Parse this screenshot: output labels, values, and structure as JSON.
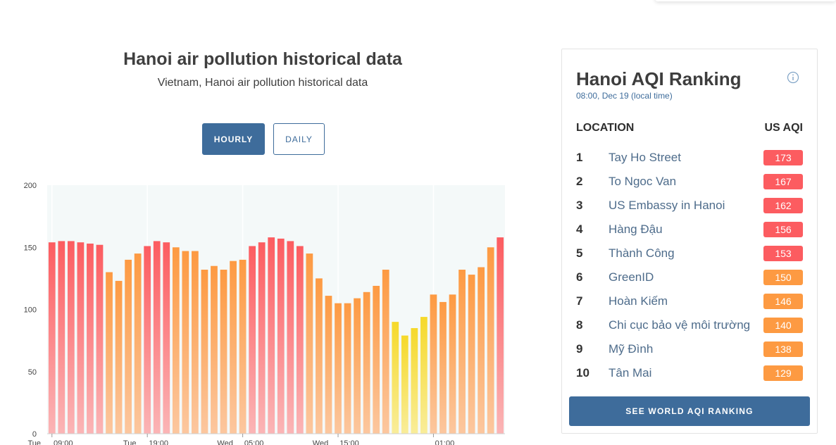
{
  "header": {
    "title": "Hanoi air pollution historical data",
    "subtitle": "Vietnam, Hanoi air pollution historical data"
  },
  "toggle": {
    "hourly_label": "HOURLY",
    "daily_label": "DAILY",
    "selected": "HOURLY"
  },
  "chart_data": {
    "type": "bar",
    "title": "",
    "xlabel": "",
    "ylabel": "",
    "ylim": [
      0,
      200
    ],
    "yticks": [
      0,
      50,
      100,
      150,
      200
    ],
    "grid": true,
    "x_tick_labels": [
      {
        "index": 0,
        "day": "Tue",
        "time": "09:00"
      },
      {
        "index": 10,
        "day": "Tue",
        "time": "19:00"
      },
      {
        "index": 20,
        "day": "Wed",
        "time": "05:00"
      },
      {
        "index": 30,
        "day": "Wed",
        "time": "15:00"
      },
      {
        "index": 40,
        "day": "",
        "time": "01:00"
      }
    ],
    "values": [
      154,
      155,
      155,
      154,
      153,
      152,
      130,
      123,
      140,
      145,
      151,
      155,
      154,
      150,
      147,
      147,
      132,
      135,
      132,
      139,
      140,
      151,
      154,
      158,
      157,
      155,
      151,
      145,
      125,
      111,
      105,
      105,
      109,
      114,
      119,
      132,
      90,
      79,
      85,
      94,
      112,
      106,
      112,
      132,
      128,
      134,
      150,
      158
    ],
    "colors": {
      "unhealthy": "#fc5c60",
      "sensitive": "#fd9a42",
      "moderate": "#f6d92a",
      "plot_background": "#f4f9f9"
    }
  },
  "ranking": {
    "title": "Hanoi AQI Ranking",
    "time": "08:00, Dec 19 (local time)",
    "info_icon": "info-circle-icon",
    "col_location": "LOCATION",
    "col_aqi": "US AQI",
    "rows": [
      {
        "rank": "1",
        "location": "Tay Ho Street",
        "aqi": "173",
        "color": "#fc5c60"
      },
      {
        "rank": "2",
        "location": "To Ngoc Van",
        "aqi": "167",
        "color": "#fc5c60"
      },
      {
        "rank": "3",
        "location": "US Embassy in Hanoi",
        "aqi": "162",
        "color": "#fc5c60"
      },
      {
        "rank": "4",
        "location": "Hàng Đậu",
        "aqi": "156",
        "color": "#fc5c60"
      },
      {
        "rank": "5",
        "location": "Thành Công",
        "aqi": "153",
        "color": "#fc5c60"
      },
      {
        "rank": "6",
        "location": "GreenID",
        "aqi": "150",
        "color": "#fd9a42"
      },
      {
        "rank": "7",
        "location": "Hoàn Kiếm",
        "aqi": "146",
        "color": "#fd9a42"
      },
      {
        "rank": "8",
        "location": "Chi cục bảo vệ môi trường",
        "aqi": "140",
        "color": "#fd9a42"
      },
      {
        "rank": "9",
        "location": "Mỹ Đình",
        "aqi": "138",
        "color": "#fd9a42"
      },
      {
        "rank": "10",
        "location": "Tân Mai",
        "aqi": "129",
        "color": "#fd9a42"
      }
    ],
    "world_button": "SEE WORLD AQI RANKING"
  }
}
